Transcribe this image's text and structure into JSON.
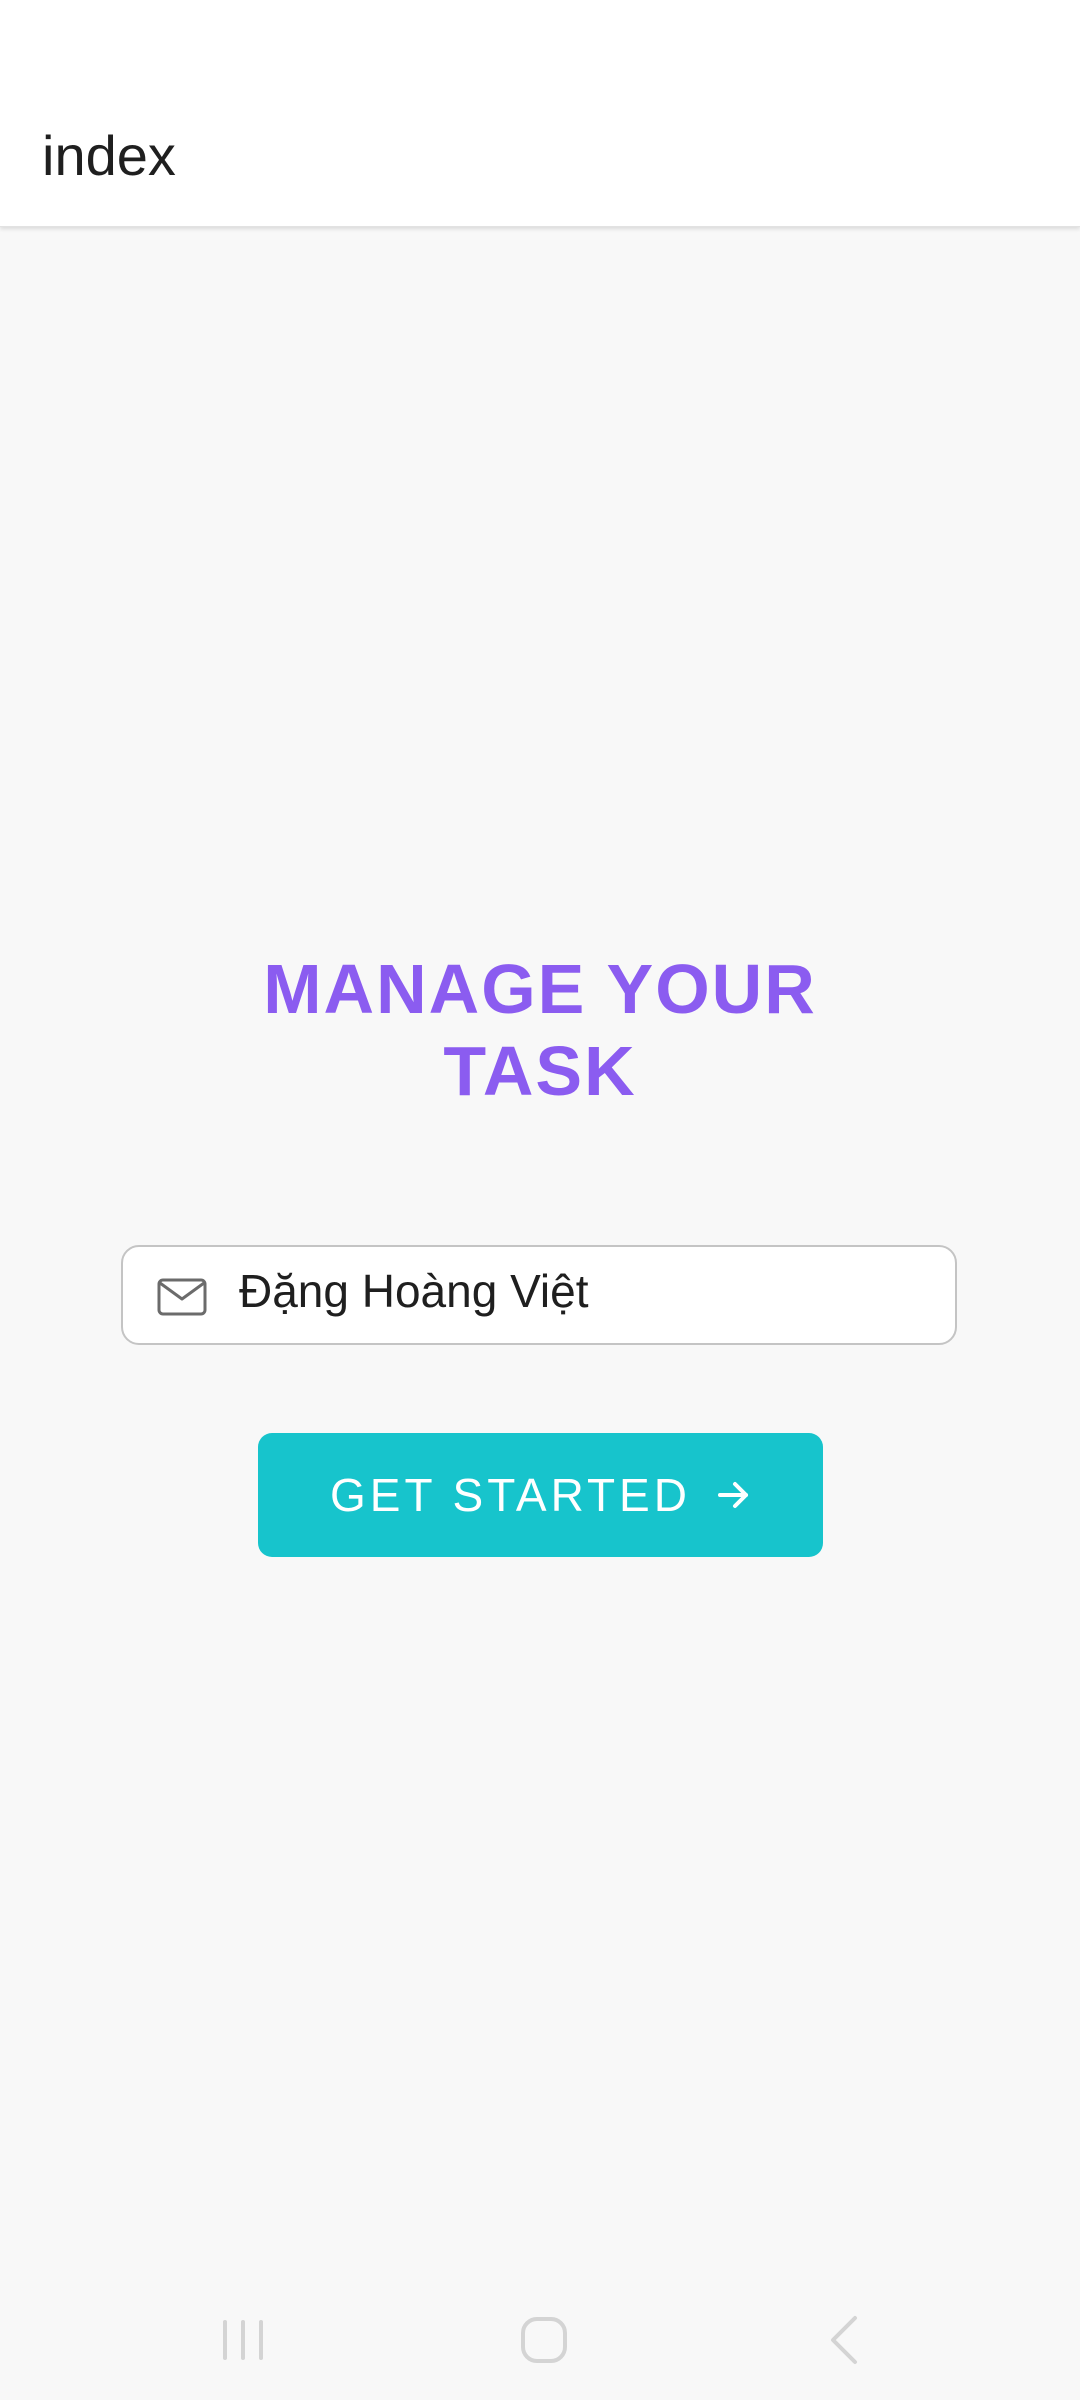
{
  "app_bar": {
    "title": "index"
  },
  "main": {
    "headline_line1": "MANAGE YOUR",
    "headline_line2": "TASK",
    "name_field": {
      "value": "Đặng Hoàng Việt",
      "icon": "mail-icon"
    },
    "cta": {
      "label": "GET STARTED",
      "icon": "arrow-right-icon"
    }
  },
  "navigation": {
    "items": [
      "recent-apps-icon",
      "home-icon",
      "back-icon"
    ]
  },
  "colors": {
    "accent_purple": "#8b5cf0",
    "button_teal": "#17c4cc",
    "background": "#f8f8f8"
  }
}
